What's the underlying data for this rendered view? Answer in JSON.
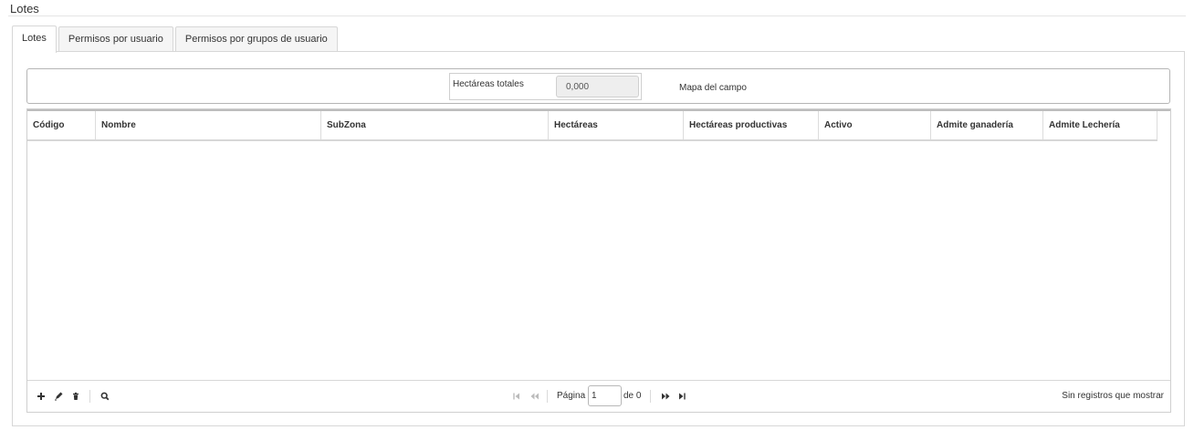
{
  "page": {
    "title": "Lotes"
  },
  "tabs": [
    {
      "label": "Lotes",
      "active": true
    },
    {
      "label": "Permisos por usuario",
      "active": false
    },
    {
      "label": "Permisos por grupos de usuario",
      "active": false
    }
  ],
  "summary": {
    "hectares_label": "Hectáreas totales",
    "hectares_value": "0,000",
    "map_link": "Mapa del campo"
  },
  "grid": {
    "columns": [
      "Código",
      "Nombre",
      "SubZona",
      "Hectáreas",
      "Hectáreas productivas",
      "Activo",
      "Admite ganadería",
      "Admite Lechería"
    ],
    "rows": []
  },
  "pager": {
    "page_label": "Página",
    "page_value": "1",
    "of_label": "de 0",
    "records_text": "Sin registros que mostrar"
  },
  "icons": {
    "add": "plus-icon",
    "edit": "pencil-icon",
    "delete": "trash-icon",
    "search": "search-icon",
    "first": "first-page-icon",
    "prev": "previous-page-icon",
    "next": "next-page-icon",
    "last": "last-page-icon"
  },
  "colors": {
    "border": "#d7d7d7",
    "tab_inactive_bg": "#f5f5f5",
    "input_disabled_bg": "#eeeeee",
    "text": "#333333"
  }
}
